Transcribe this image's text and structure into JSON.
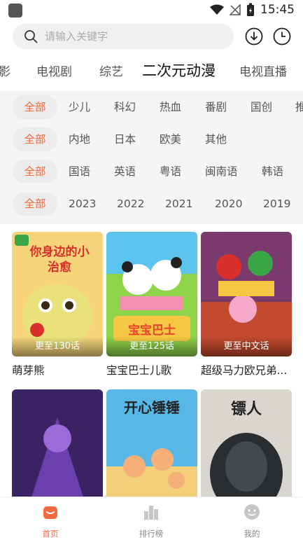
{
  "status": {
    "time": "15:45"
  },
  "search": {
    "placeholder": "请输入关键字"
  },
  "categories": [
    "影",
    "电视剧",
    "综艺",
    "二次元动漫",
    "电视直播"
  ],
  "filters": {
    "genre": [
      "全部",
      "少儿",
      "科幻",
      "热血",
      "番剧",
      "国创",
      "推"
    ],
    "region": [
      "全部",
      "内地",
      "日本",
      "欧美",
      "其他"
    ],
    "language": [
      "全部",
      "国语",
      "英语",
      "粤语",
      "闽南语",
      "韩语"
    ],
    "year": [
      "全部",
      "2023",
      "2022",
      "2021",
      "2020",
      "2019"
    ]
  },
  "cards": [
    {
      "title": "萌芽熊",
      "caption": "更至130话",
      "art": "你身边的小治愈",
      "color": "#f1b64a"
    },
    {
      "title": "宝宝巴士儿歌",
      "caption": "更至125话",
      "art": "宝宝巴士",
      "color": "#3db8e8"
    },
    {
      "title": "超级马力欧兄弟...",
      "caption": "更至中文话",
      "art": "",
      "color": "#b53a3a"
    },
    {
      "title": "",
      "caption": "",
      "art": "",
      "color": "#4a2d7a"
    },
    {
      "title": "",
      "caption": "",
      "art": "开心锤锤",
      "color": "#57b8e8"
    },
    {
      "title": "",
      "caption": "",
      "art": "镖人",
      "color": "#d9d6cf"
    }
  ],
  "nav": [
    {
      "label": "首页",
      "icon": "home-icon"
    },
    {
      "label": "排行榜",
      "icon": "ranking-icon"
    },
    {
      "label": "我的",
      "icon": "profile-icon"
    }
  ],
  "colors": {
    "accent": "#f26a3d",
    "chip_bg": "#ececec",
    "filter_bg": "#f5f5f7"
  }
}
